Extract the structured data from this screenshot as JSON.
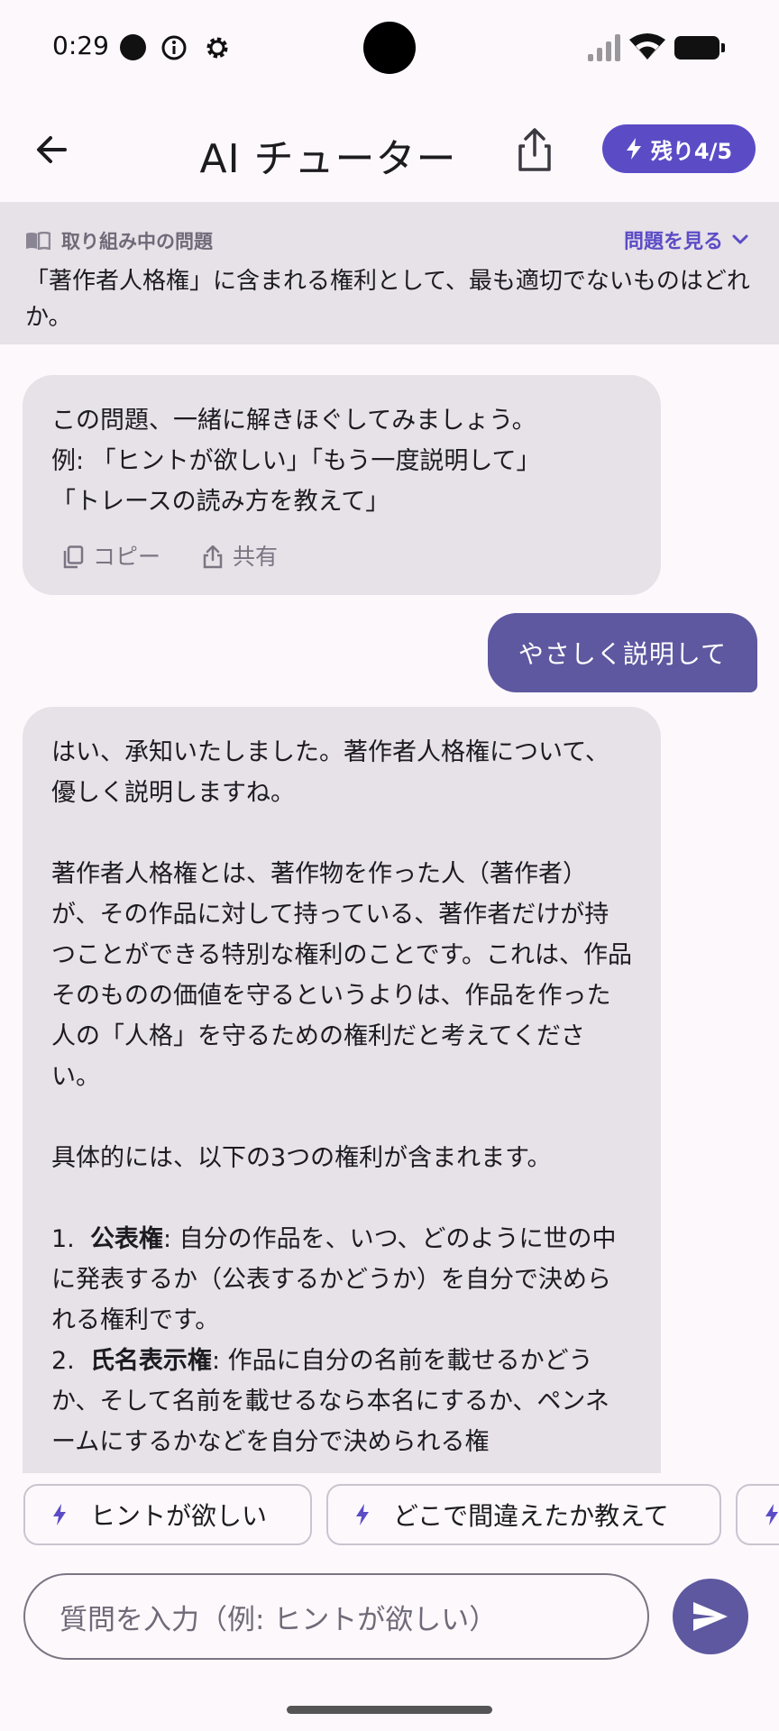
{
  "status_bar": {
    "time": "0:29"
  },
  "app_bar": {
    "title": "AI チューター",
    "remaining": "残り4/5"
  },
  "problem": {
    "label": "取り組み中の問題",
    "link": "問題を見る",
    "text": "「著作者人格権」に含まれる権利として、最も適切でないものはどれか。"
  },
  "messages": {
    "ai_1": {
      "text": "この問題、一緒に解きほぐしてみましょう。\n例: 「ヒントが欲しい」「もう一度説明して」\n「トレースの読み方を教えて」",
      "copy": "コピー",
      "share": "共有"
    },
    "user_1": "やさしく説明して",
    "ai_2": {
      "p1": "はい、承知いたしました。著作者人格権について、優しく説明しますね。",
      "p2": "著作者人格権とは、著作物を作った人（著作者）が、その作品に対して持っている、著作者だけが持つことができる特別な権利のことです。これは、作品そのものの価値を守るというよりは、作品を作った人の「人格」を守るための権利だと考えてください。",
      "p3": "具体的には、以下の3つの権利が含まれます。",
      "item1_num": "1.",
      "item1_term": "公表権",
      "item1_text": ": 自分の作品を、いつ、どのように世の中に発表するか（公表するかどうか）を自分で決められる権利です。",
      "item2_num": "2.",
      "item2_term": "氏名表示権",
      "item2_text": ": 作品に自分の名前を載せるかどうか、そして名前を載せるなら本名にするか、ペンネームにするかなどを自分で決められる権"
    }
  },
  "chips": [
    "ヒントが欲しい",
    "どこで間違えたか教えて",
    ""
  ],
  "input": {
    "placeholder": "質問を入力（例: ヒントが欲しい）"
  }
}
